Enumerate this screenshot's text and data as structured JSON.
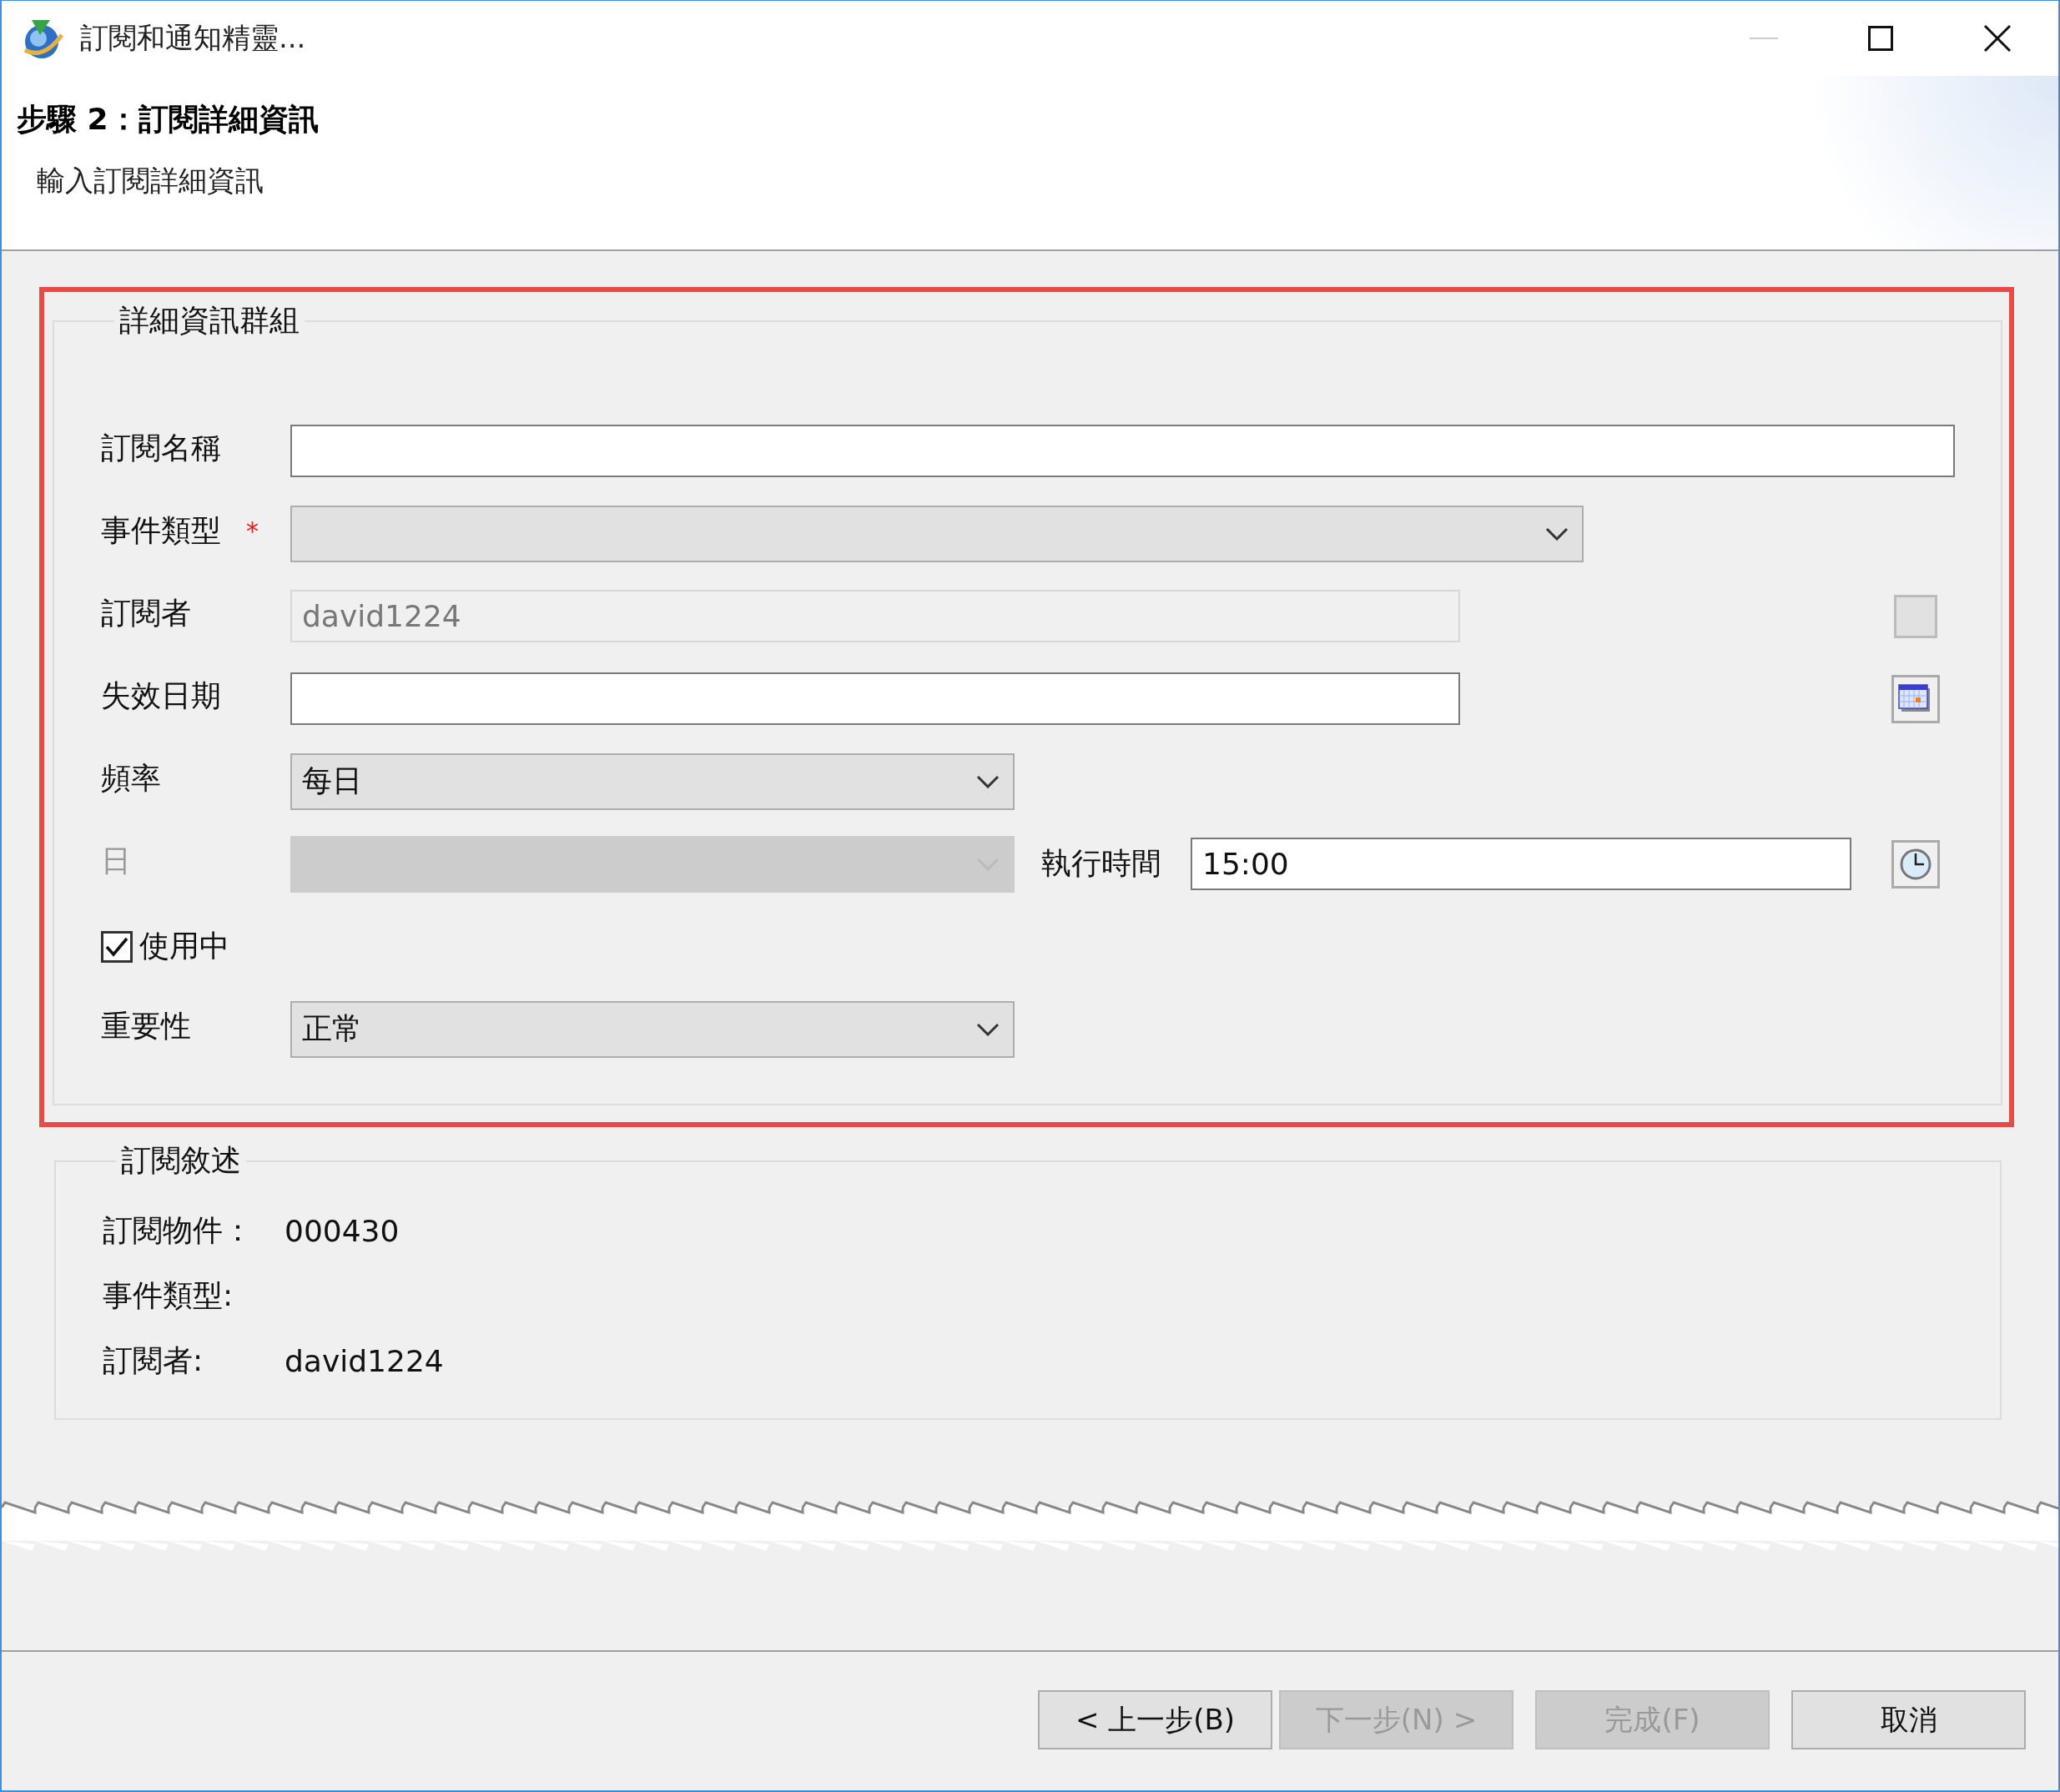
{
  "window": {
    "title": "訂閱和通知精靈..."
  },
  "header": {
    "title": "步驟 2：訂閱詳細資訊",
    "subtitle": "輸入訂閱詳細資訊"
  },
  "details_group": {
    "title": "詳細資訊群組",
    "highlighted": true,
    "fields": [
      {
        "kind": "text",
        "label": "訂閱名稱",
        "disabled": false
      },
      {
        "kind": "combo",
        "label": "事件類型",
        "required_mark": "*",
        "disabled": false
      },
      {
        "kind": "text",
        "label": "訂閱者",
        "value": "david1224",
        "disabled": true,
        "button": {
          "kind": "blank"
        }
      },
      {
        "kind": "text",
        "label": "失效日期",
        "disabled": false,
        "button": {
          "kind": "calendar"
        }
      },
      {
        "kind": "combo",
        "label": "頻率",
        "value": "每日",
        "disabled": false
      },
      {
        "kind": "combo",
        "label": "日",
        "disabled": true,
        "extra": {
          "label": "執行時間",
          "value": "15:00",
          "button": {
            "kind": "clock"
          }
        }
      },
      {
        "kind": "checkbox",
        "label": "使用中",
        "checked": true
      },
      {
        "kind": "combo",
        "label": "重要性",
        "value": "正常",
        "disabled": false
      }
    ]
  },
  "summary_group": {
    "title": "訂閱敘述",
    "rows": [
      {
        "label": "訂閱物件：",
        "value": "000430"
      },
      {
        "label": "事件類型:"
      },
      {
        "label": "訂閱者:",
        "value": "david1224"
      }
    ]
  },
  "buttons": [
    {
      "label": "< 上一步(B)",
      "disabled": false
    },
    {
      "label": "下一步(N) >",
      "disabled": true
    },
    {
      "label": "完成(F)",
      "disabled": true
    },
    {
      "label": "取消",
      "disabled": false
    }
  ]
}
